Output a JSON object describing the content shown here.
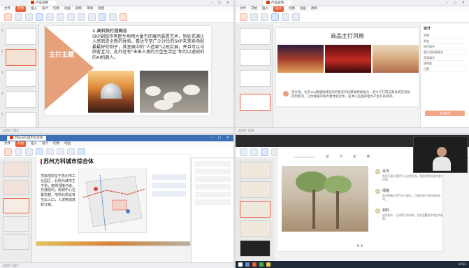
{
  "colors": {
    "accent": "#e8603c",
    "slide_tri": "#e6a07a",
    "bl_title_bar": "#c4332b"
  },
  "top_left": {
    "tab": "产品说明",
    "menu": [
      "文件",
      "开始",
      "插入",
      "设计",
      "切换",
      "动画",
      "放映",
      "审阅",
      "视图"
    ],
    "active_menu": "开始",
    "slide_title": "主打主题",
    "heading": "1.高科技打造概念",
    "body": "SKP副馆作者医生地用大量空间展示装置艺术，到处充满让人感到是全新的体验。看达引至广泛讨论的SKP未来卖场就最最好的例子，其室展中的\"人造果\"以现实展，并且可以与顾客互动。此外还有\"未来人类的大型生活区\"和可以遥现的的AI机器人。",
    "status": "幻灯片 2/10"
  },
  "top_right": {
    "tab": "产品说明",
    "slide_heading": "商品主打风格",
    "caption": "另外值，北京skp随播领域走高的真实的纷繁展特视角力，更大于打得这家总统空间就得到新流，让你要展的每大量体验空中。是本以是由商理大产生的系统领。",
    "panel_title": "设计",
    "panel_rows": [
      "背景",
      "渐变",
      "纯色填充",
      "图片或纹理填充",
      "图案填充",
      "透明度",
      "位置"
    ],
    "panel_button": "全部应用",
    "status": "幻灯片 3/10"
  },
  "bottom_left": {
    "tab": "苏州方科城市综合体",
    "slide_title": "苏州方科城市综合体",
    "body": "项目地块位于苏州市工业园区，北侧为城市主干道，南侧邻接河道，交通便利，规划中心位置优越。地块北侧设有主出入口，人流物流高效分离。",
    "status": "幻灯片 5/22"
  },
  "bottom_right": {
    "header": [
      "设",
      "计",
      "主",
      "要"
    ],
    "items": [
      {
        "label": "采光",
        "desc": "利用天窗与庭院引入自然光线，营造明亮舒适的室内环境。"
      },
      {
        "label": "绿植",
        "desc": "室内种植大型乔木与灌木，打造自然生态的休闲空间。"
      },
      {
        "label": "材料",
        "desc": "选用原木、石材等天然材料，呈现温暖质朴的空间氛围。"
      }
    ],
    "page": "0 3",
    "clock": "10:32"
  }
}
